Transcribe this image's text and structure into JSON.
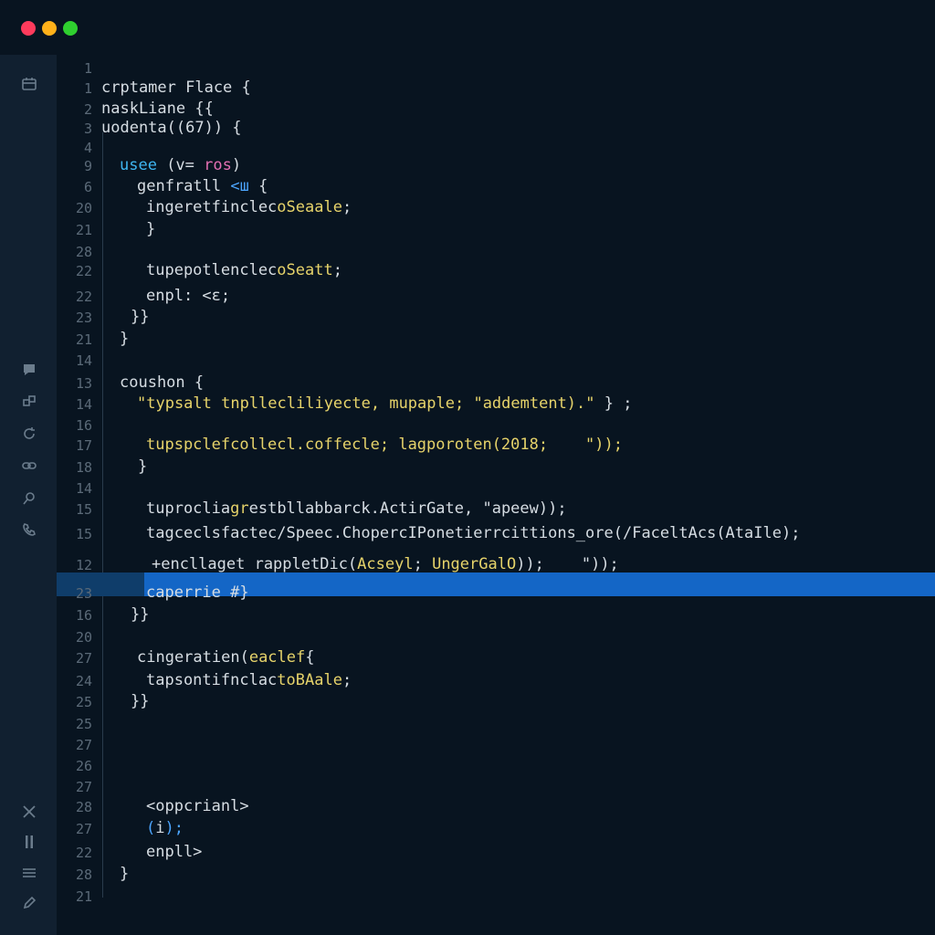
{
  "window": {
    "buttons": [
      {
        "name": "close",
        "color": "#ff3b5c"
      },
      {
        "name": "minimize",
        "color": "#ffb11a"
      },
      {
        "name": "maximize",
        "color": "#2fd02f"
      }
    ]
  },
  "activity_bar": {
    "icons": [
      "calendar-icon",
      "chat-icon",
      "extensions-icon",
      "refresh-icon",
      "link-icon",
      "search-icon",
      "phone-icon",
      "close-icon",
      "pause-icon",
      "menu-icon",
      "pencil-icon"
    ]
  },
  "colors": {
    "default": "#d6dde3",
    "keyword": "#3fb6f2",
    "pink": "#e46fb3",
    "yellow": "#e6d36a",
    "blue": "#4da6ff",
    "line_number": "#5b6a78",
    "selection": "#1466c6",
    "current_line": "#0f3d6a"
  },
  "editor": {
    "lines": [
      {
        "num": "1",
        "tokens": []
      },
      {
        "num": "1",
        "tokens": [
          {
            "t": "crptamer Flace {",
            "c": "default"
          }
        ]
      },
      {
        "num": "2",
        "tokens": [
          {
            "t": "naskLiane {{",
            "c": "default"
          }
        ]
      },
      {
        "num": "3",
        "tokens": [
          {
            "t": "uodenta((67)) {",
            "c": "default"
          }
        ]
      },
      {
        "num": "4",
        "tokens": []
      },
      {
        "num": "9",
        "tokens": [
          {
            "t": "usee ",
            "c": "keyword"
          },
          {
            "t": "(v= ",
            "c": "default"
          },
          {
            "t": "ros",
            "c": "pink"
          },
          {
            "t": ")",
            "c": "default"
          }
        ]
      },
      {
        "num": "6",
        "tokens": [
          {
            "t": "genfratll ",
            "c": "default"
          },
          {
            "t": "<ш",
            "c": "blue"
          },
          {
            "t": " {",
            "c": "default"
          }
        ]
      },
      {
        "num": "20",
        "tokens": [
          {
            "t": "ingeretfinclec",
            "c": "default"
          },
          {
            "t": "oSeaale",
            "c": "yellow"
          },
          {
            "t": ";",
            "c": "default"
          }
        ]
      },
      {
        "num": "21",
        "tokens": [
          {
            "t": "}",
            "c": "default"
          }
        ]
      },
      {
        "num": "28",
        "tokens": []
      },
      {
        "num": "22",
        "tokens": [
          {
            "t": "tupepotlenclec",
            "c": "default"
          },
          {
            "t": "oSeatt",
            "c": "yellow"
          },
          {
            "t": ";",
            "c": "default"
          }
        ]
      },
      {
        "num": "22",
        "tokens": [
          {
            "t": "enpl: <ɛ;",
            "c": "default"
          }
        ]
      },
      {
        "num": "23",
        "tokens": [
          {
            "t": "}}",
            "c": "default"
          }
        ]
      },
      {
        "num": "21",
        "tokens": [
          {
            "t": "}",
            "c": "default"
          }
        ]
      },
      {
        "num": "14",
        "tokens": []
      },
      {
        "num": "13",
        "tokens": [
          {
            "t": "coushon {",
            "c": "default"
          }
        ]
      },
      {
        "num": "14",
        "tokens": [
          {
            "t": "\"typsalt tnpllecliliyecte, mupaple; \"addemtent).\"",
            "c": "yellow"
          },
          {
            "t": " } ;",
            "c": "default"
          }
        ]
      },
      {
        "num": "16",
        "tokens": []
      },
      {
        "num": "17",
        "tokens": [
          {
            "t": "tupspclefcollecl.coffecle; lagporoten(2018;    \"));",
            "c": "yellow"
          }
        ]
      },
      {
        "num": "18",
        "tokens": [
          {
            "t": "}",
            "c": "default"
          }
        ]
      },
      {
        "num": "14",
        "tokens": []
      },
      {
        "num": "15",
        "tokens": [
          {
            "t": "tuproclia",
            "c": "default"
          },
          {
            "t": "gr",
            "c": "yellow"
          },
          {
            "t": "estbllabbarck.ActirGate, \"apeew));",
            "c": "default"
          }
        ]
      },
      {
        "num": "15",
        "tokens": [
          {
            "t": "tagceclsfactec/Speec.ChopercIPonetierrcittions_ore(/FaceltAcs(AtaIle);",
            "c": "default"
          }
        ]
      },
      {
        "num": "12",
        "tokens": [
          {
            "t": "+encllaget rappletDic(",
            "c": "default"
          },
          {
            "t": "Acseyl",
            "c": "yellow"
          },
          {
            "t": "; ",
            "c": "default"
          },
          {
            "t": "UngerGalO",
            "c": "yellow"
          },
          {
            "t": "));    \"));",
            "c": "default"
          }
        ]
      },
      {
        "num": "23",
        "tokens": [
          {
            "t": "caperrie #}",
            "c": "default"
          }
        ]
      },
      {
        "num": "16",
        "tokens": [
          {
            "t": "}}",
            "c": "default"
          }
        ]
      },
      {
        "num": "20",
        "tokens": []
      },
      {
        "num": "27",
        "tokens": [
          {
            "t": "cingeratien(",
            "c": "default"
          },
          {
            "t": "eaclef",
            "c": "yellow"
          },
          {
            "t": "{",
            "c": "default"
          }
        ]
      },
      {
        "num": "24",
        "tokens": [
          {
            "t": "tapsontifnclac",
            "c": "default"
          },
          {
            "t": "toBAale",
            "c": "yellow"
          },
          {
            "t": ";",
            "c": "default"
          }
        ]
      },
      {
        "num": "25",
        "tokens": [
          {
            "t": "}}",
            "c": "default"
          }
        ]
      },
      {
        "num": "25",
        "tokens": []
      },
      {
        "num": "27",
        "tokens": []
      },
      {
        "num": "26",
        "tokens": []
      },
      {
        "num": "27",
        "tokens": []
      },
      {
        "num": "28",
        "tokens": [
          {
            "t": "<oppcrianl>",
            "c": "default"
          }
        ]
      },
      {
        "num": "27",
        "tokens": [
          {
            "t": "(",
            "c": "blue"
          },
          {
            "t": "i",
            "c": "default"
          },
          {
            "t": ");",
            "c": "blue"
          }
        ]
      },
      {
        "num": "22",
        "tokens": [
          {
            "t": "enpll>",
            "c": "default"
          }
        ]
      },
      {
        "num": "28",
        "tokens": [
          {
            "t": "}",
            "c": "default"
          }
        ]
      },
      {
        "num": "21",
        "tokens": []
      }
    ]
  }
}
